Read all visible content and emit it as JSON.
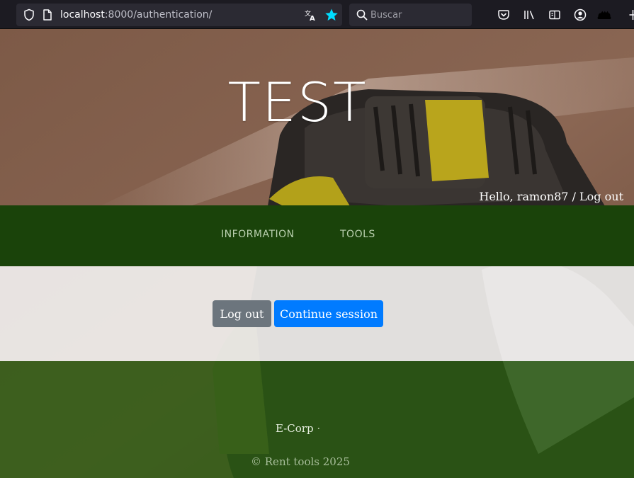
{
  "browser": {
    "url_host": "localhost",
    "url_path": ":8000/authentication/",
    "search_placeholder": "Buscar",
    "accent_color": "#00ddff"
  },
  "hero": {
    "site_title": "TEST",
    "greeting": "Hello, ramon87",
    "greeting_separator": " / ",
    "logout_link": "Log out"
  },
  "nav": {
    "items": [
      {
        "label": "INFORMATION"
      },
      {
        "label": "TOOLS"
      }
    ],
    "bg_color": "#1a430a"
  },
  "main": {
    "logout_button": "Log out",
    "continue_button": "Continue session",
    "logout_color": "#6c757d",
    "continue_color": "#007bff"
  },
  "footer": {
    "company": "E-Corp",
    "company_separator": "·",
    "copyright": "© Rent tools 2025"
  },
  "icons": [
    "shield-icon",
    "page-icon",
    "translate-icon",
    "bookmark-star-icon",
    "search-icon",
    "pocket-icon",
    "library-icon",
    "reader-view-icon",
    "account-icon",
    "extension-icon",
    "overflow-icon"
  ]
}
